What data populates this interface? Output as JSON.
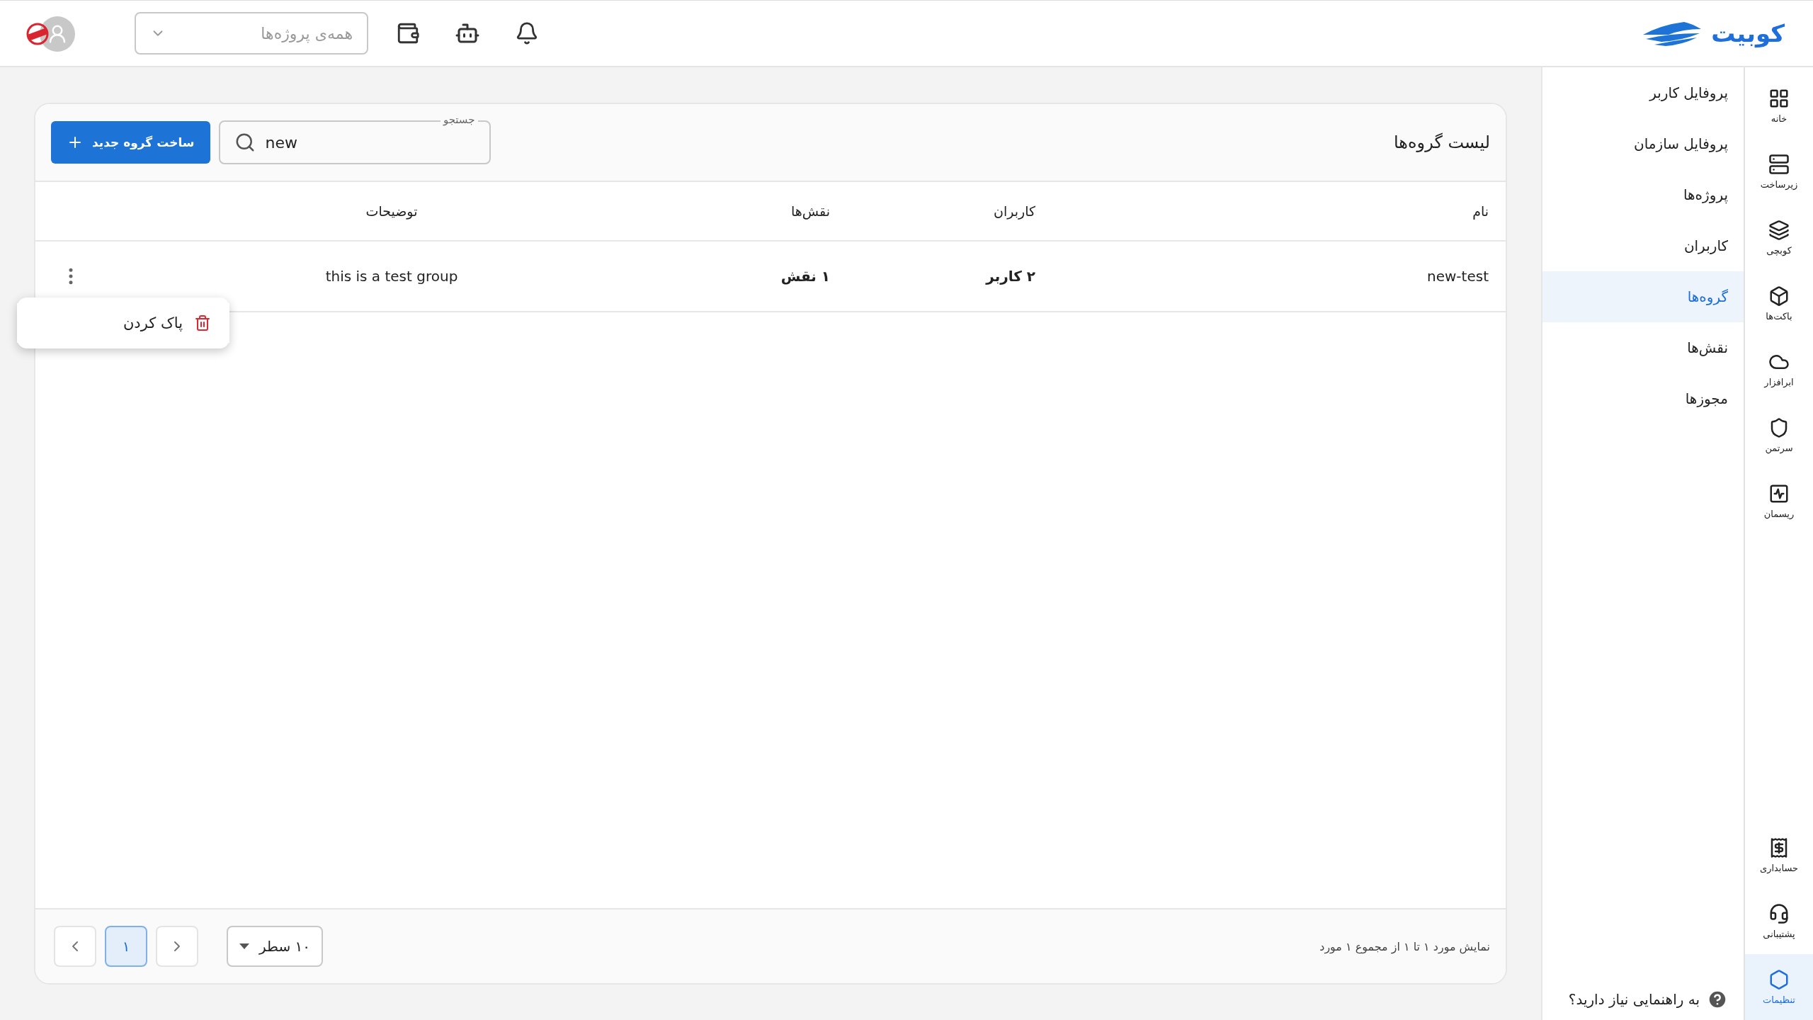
{
  "header": {
    "logo": "کوبیت",
    "project_select": {
      "placeholder": "همه‌ی پروژه‌ها"
    }
  },
  "rail_top": [
    {
      "label": "خانه",
      "selected": false
    },
    {
      "label": "زیرساخت",
      "selected": false
    },
    {
      "label": "کوبچی",
      "selected": false
    },
    {
      "label": "باکت‌ها",
      "selected": false
    },
    {
      "label": "ابرافزار",
      "selected": false
    },
    {
      "label": "سرتمن",
      "selected": false
    },
    {
      "label": "ریسمان",
      "selected": false
    }
  ],
  "rail_bottom": [
    {
      "label": "حسابداری",
      "selected": false
    },
    {
      "label": "پشتیبانی",
      "selected": false
    },
    {
      "label": "تنظیمات",
      "selected": true
    }
  ],
  "submenu": {
    "items": [
      {
        "label": "پروفایل کاربر",
        "selected": false
      },
      {
        "label": "پروفایل سازمان",
        "selected": false
      },
      {
        "label": "پروژه‌ها",
        "selected": false
      },
      {
        "label": "کاربران",
        "selected": false
      },
      {
        "label": "گروه‌ها",
        "selected": true
      },
      {
        "label": "نقش‌ها",
        "selected": false
      },
      {
        "label": "مجوزها",
        "selected": false
      }
    ],
    "help": "به راهنمایی نیاز دارید؟"
  },
  "card": {
    "title": "لیست گروه‌ها",
    "search": {
      "label": "جستجو",
      "value": "new"
    },
    "create_button": "ساخت گروه جدید",
    "columns": [
      "نام",
      "کاربران",
      "نقش‌ها",
      "توضیحات"
    ],
    "rows": [
      {
        "cells": [
          "new-test",
          "۲ کاربر",
          "۱ نقش",
          "this is a test group"
        ]
      }
    ],
    "row_menu": {
      "items": [
        {
          "label": "پاک کردن"
        }
      ]
    },
    "footer": {
      "summary": "نمایش مورد ۱ تا ۱ از مجموع ۱ مورد",
      "rows_per_page": "۱۰ سطر",
      "pages": [
        {
          "label": "۱",
          "selected": true
        }
      ]
    }
  }
}
